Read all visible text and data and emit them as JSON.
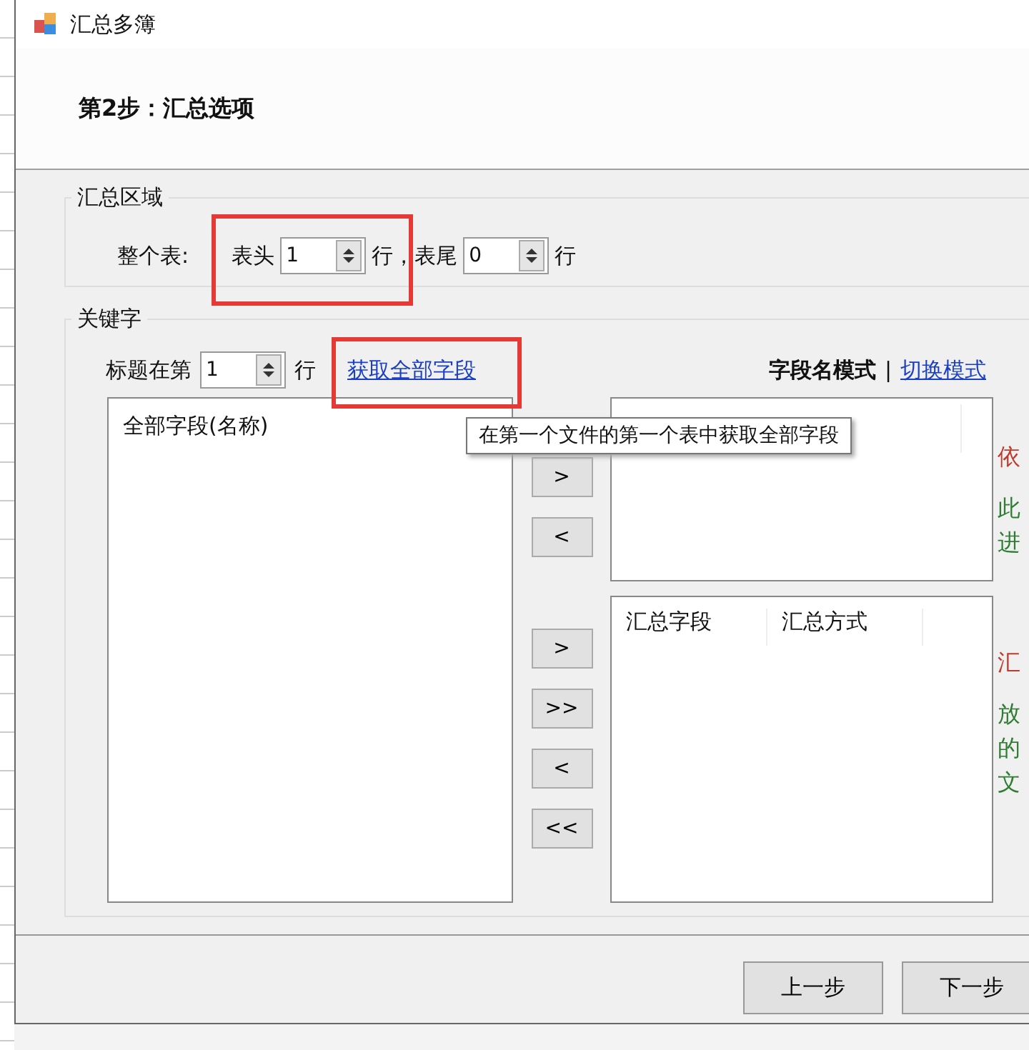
{
  "window": {
    "title": "汇总多簿"
  },
  "step_title": "第2步：汇总选项",
  "summary_area": {
    "legend": "汇总区域",
    "label": "整个表:",
    "header_label": "表头",
    "header_value": "1",
    "header_highlighted": true,
    "mid_label": "行，表尾",
    "footer_value": "0",
    "end_label": "行"
  },
  "keyword": {
    "legend": "关键字",
    "title_row_label": "标题在第",
    "title_row_value": "1",
    "row_unit": "行",
    "fetch_link": {
      "text": "获取全部字段",
      "highlighted": true
    },
    "mode_label": "字段名模式",
    "separator": "|",
    "switch_link": "切换模式",
    "all_fields_list": {
      "header": "全部字段(名称)"
    },
    "top_buttons": [
      ">",
      "<"
    ],
    "bottom_buttons": [
      ">",
      ">>",
      "<",
      "<<"
    ],
    "summary_list": {
      "columns": [
        "汇总字段",
        "汇总方式"
      ]
    },
    "side_notes": [
      {
        "kind": "heading",
        "lines": [
          "依"
        ]
      },
      {
        "kind": "hint",
        "lines": [
          "此",
          "进"
        ]
      },
      {
        "kind": "heading",
        "lines": [
          "汇"
        ]
      },
      {
        "kind": "hint",
        "lines": [
          "放",
          "的",
          "文"
        ]
      }
    ]
  },
  "tooltip": "在第一个文件的第一个表中获取全部字段",
  "buttons": [
    "上一步",
    "下一步"
  ]
}
